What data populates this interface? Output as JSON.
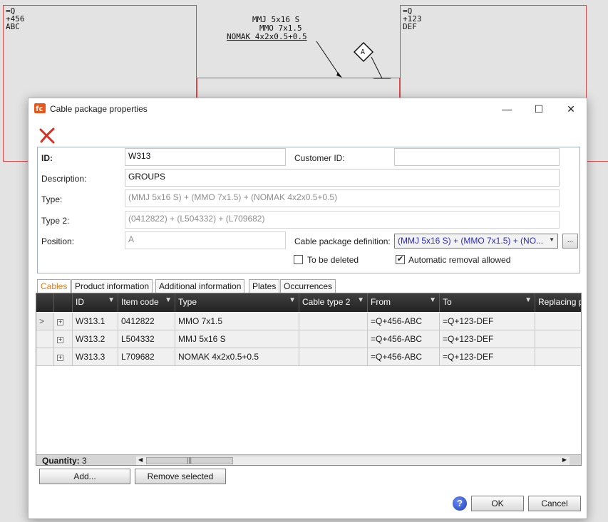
{
  "cad": {
    "left_box": [
      "=Q",
      "+456",
      "ABC"
    ],
    "right_box": [
      "=Q",
      "+123",
      "DEF"
    ],
    "cable_labels": [
      "MMJ 5x16 S",
      "MMO 7x1.5",
      "NOMAK 4x2x0.5+0.5"
    ],
    "marker": "A"
  },
  "dialog": {
    "title": "Cable package properties",
    "window_controls": {
      "minimize": "—",
      "maximize": "☐",
      "close": "✕"
    }
  },
  "props": {
    "id_label": "ID:",
    "id_value": "W313",
    "customer_id_label": "Customer ID:",
    "customer_id_value": "",
    "description_label": "Description:",
    "description_value": "GROUPS",
    "type_label": "Type:",
    "type_value": "(MMJ 5x16 S) + (MMO 7x1.5) + (NOMAK 4x2x0.5+0.5)",
    "type2_label": "Type 2:",
    "type2_value": "(0412822) + (L504332) + (L709682)",
    "position_label": "Position:",
    "position_value": "A",
    "definition_label": "Cable package definition:",
    "definition_value": "(MMJ 5x16 S) + (MMO 7x1.5) + (NO...",
    "browse_label": "...",
    "to_be_deleted_label": "To be deleted",
    "to_be_deleted_checked": false,
    "auto_removal_label": "Automatic removal allowed",
    "auto_removal_checked": true
  },
  "tabs": [
    "Cables",
    "Product information",
    "Additional information",
    "Plates",
    "Occurrences"
  ],
  "grid": {
    "columns": [
      "ID",
      "Item code",
      "Type",
      "Cable type 2",
      "From",
      "To",
      "Replacing p"
    ],
    "rows": [
      {
        "indicator": ">",
        "expand": "+",
        "id": "W313.1",
        "item_code": "0412822",
        "type": "MMO 7x1.5",
        "cable_type2": "",
        "from": "=Q+456-ABC",
        "to": "=Q+123-DEF"
      },
      {
        "indicator": "",
        "expand": "+",
        "id": "W313.2",
        "item_code": "L504332",
        "type": "MMJ 5x16 S",
        "cable_type2": "",
        "from": "=Q+456-ABC",
        "to": "=Q+123-DEF"
      },
      {
        "indicator": "",
        "expand": "+",
        "id": "W313.3",
        "item_code": "L709682",
        "type": "NOMAK 4x2x0.5+0.5",
        "cable_type2": "",
        "from": "=Q+456-ABC",
        "to": "=Q+123-DEF"
      }
    ],
    "quantity_label": "Quantity:",
    "quantity_value": "3"
  },
  "buttons": {
    "add": "Add...",
    "remove_selected": "Remove selected",
    "ok": "OK",
    "cancel": "Cancel",
    "help": "?"
  }
}
